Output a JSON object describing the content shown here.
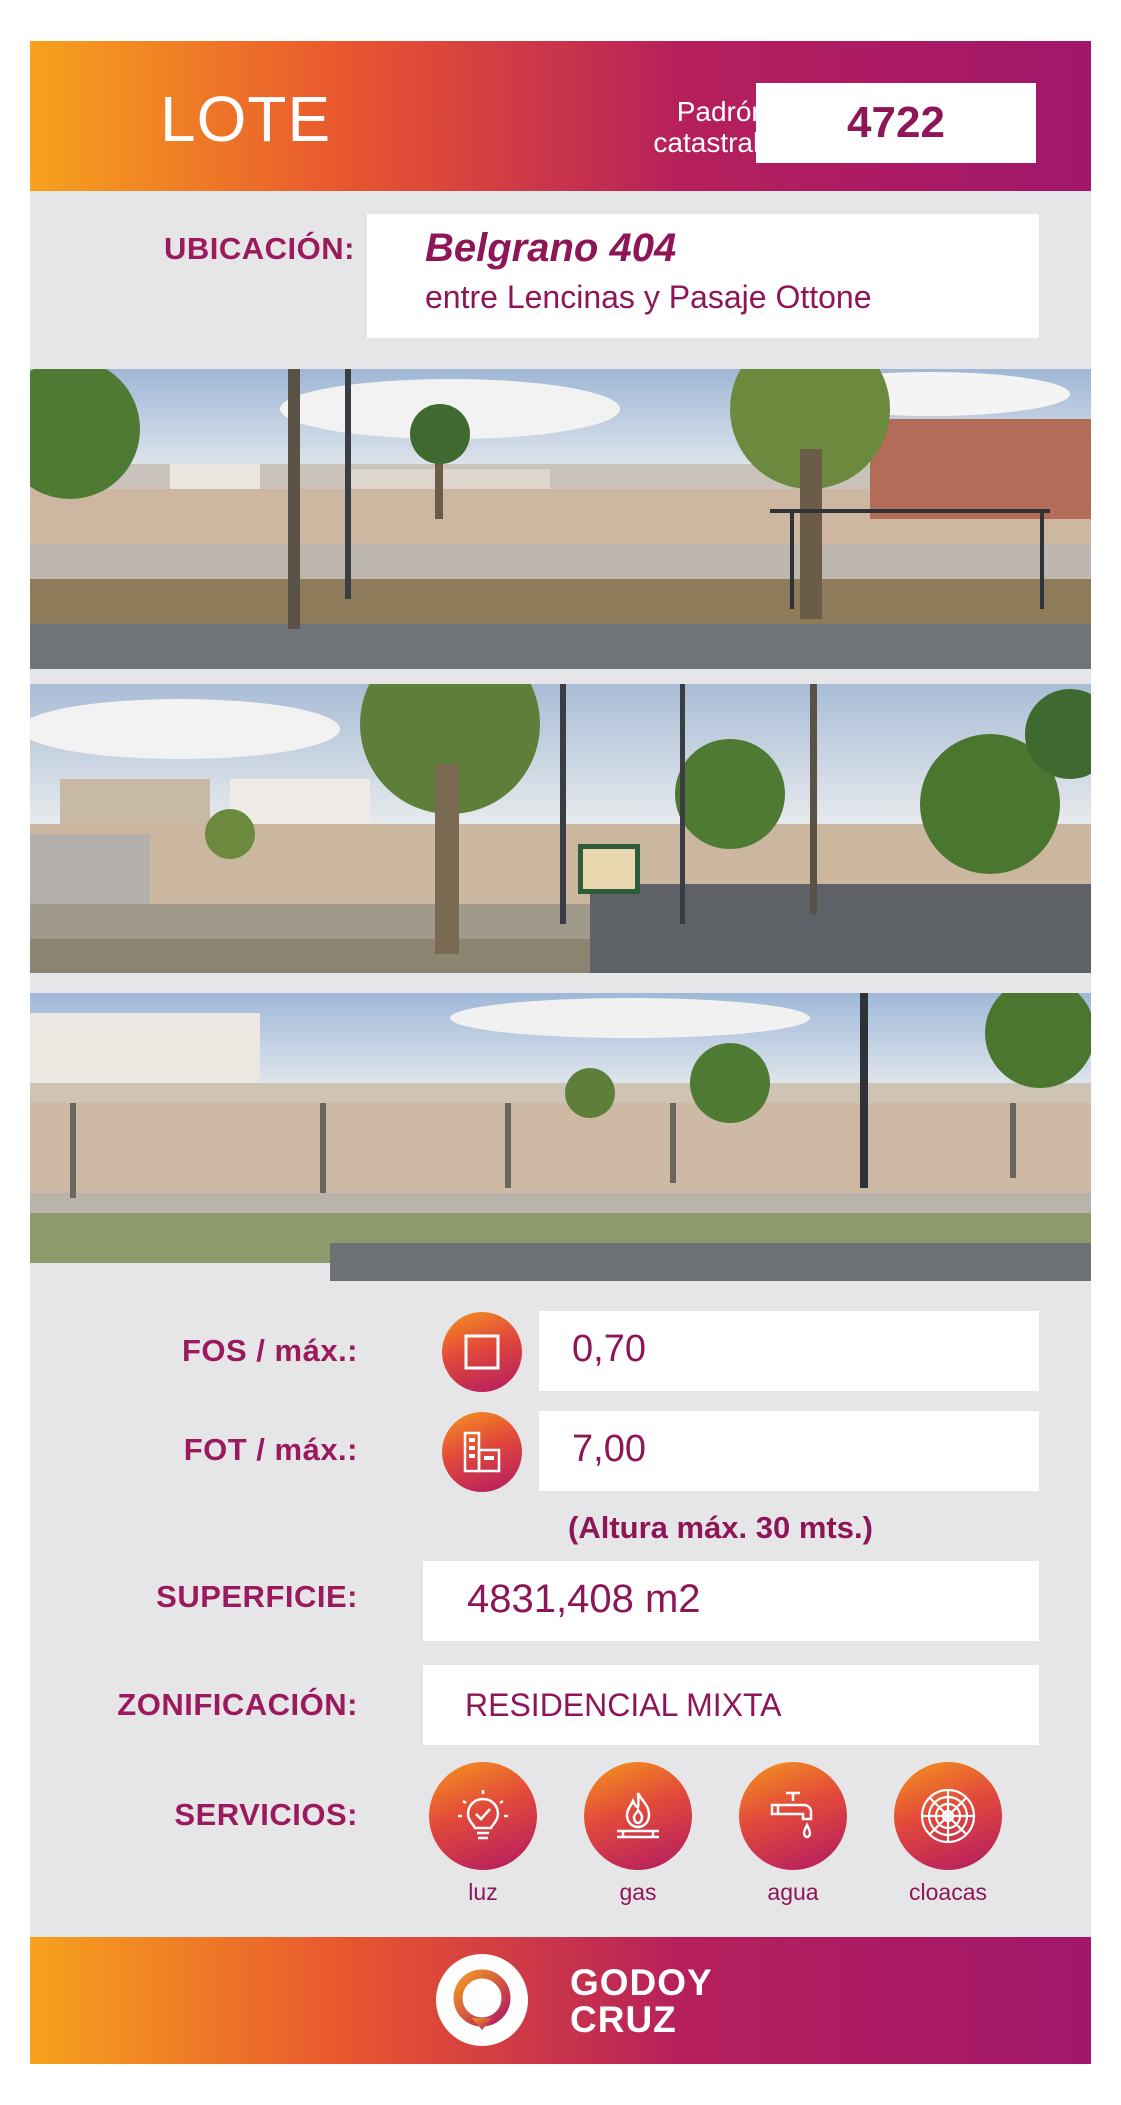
{
  "header": {
    "title": "LOTE",
    "padron_label_line1": "Padrón",
    "padron_label_line2": "catastral:",
    "padron_value": "4722"
  },
  "ubicacion": {
    "label": "UBICACIÓN:",
    "street": "Belgrano 404",
    "between": "entre Lencinas y Pasaje Ottone"
  },
  "photos": [
    "street-view-photo-1",
    "street-view-photo-2",
    "street-view-photo-3"
  ],
  "fos": {
    "label": "FOS / máx.:",
    "value": "0,70",
    "icon": "square-icon"
  },
  "fot": {
    "label": "FOT / máx.:",
    "value": "7,00",
    "icon": "buildings-icon",
    "note": "(Altura máx. 30 mts.)"
  },
  "superficie": {
    "label": "SUPERFICIE:",
    "value": "4831,408 m2"
  },
  "zonificacion": {
    "label": "ZONIFICACIÓN:",
    "value": "RESIDENCIAL MIXTA"
  },
  "servicios": {
    "label": "SERVICIOS:",
    "items": [
      {
        "label": "luz",
        "icon": "lightbulb-icon"
      },
      {
        "label": "gas",
        "icon": "flame-icon"
      },
      {
        "label": "agua",
        "icon": "faucet-icon"
      },
      {
        "label": "cloacas",
        "icon": "drain-icon"
      }
    ]
  },
  "footer": {
    "brand_line1": "GODOY",
    "brand_line2": "CRUZ"
  },
  "colors": {
    "accent": "#9b1a5e",
    "gradient_start": "#f6a21d",
    "gradient_end": "#a1176b",
    "panel": "#e6e6e8"
  }
}
